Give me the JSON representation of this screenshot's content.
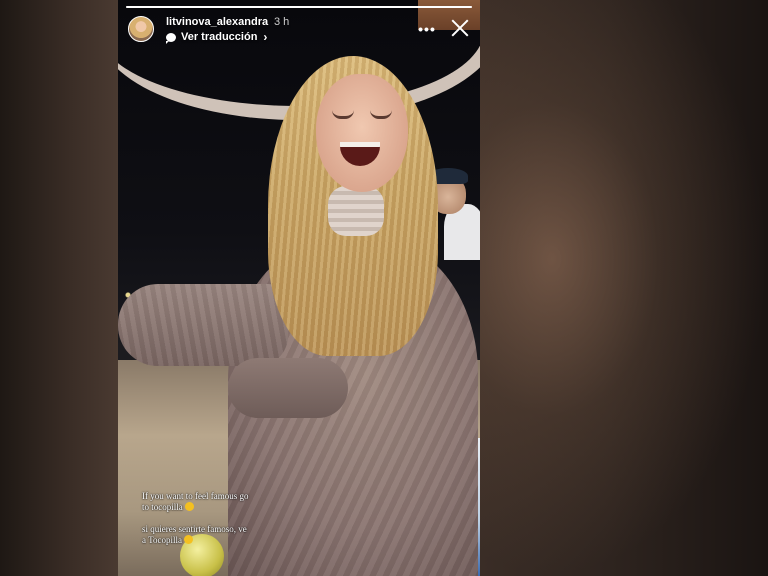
{
  "story": {
    "username": "litvinova_alexandra",
    "time_ago": "3 h",
    "translate_label": "Ver traducción",
    "progress": 1.0,
    "caption_en_line1": "If you want to feel famous go",
    "caption_en_line2": "to tocopilla",
    "caption_es_line1": "si quieres sentirte famoso, ve",
    "caption_es_line2": "a Tocopilla",
    "emoji": "laughing-tears-emoji"
  },
  "icons": {
    "more": "more-options-icon",
    "close": "close-icon",
    "translate": "chat-bubble-icon",
    "chevron": "chevron-right-icon"
  },
  "colors": {
    "text": "#ffffff"
  }
}
